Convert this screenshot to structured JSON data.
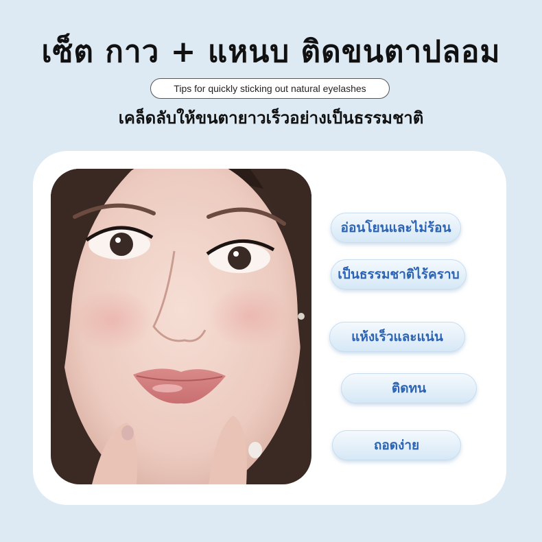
{
  "header": {
    "title": "เซ็ต กาว + แหนบ ติดขนตาปลอม",
    "subtitle_en": "Tips for quickly sticking out natural eyelashes",
    "subtitle_th": "เคล็ดลับให้ขนตายาวเร็วอย่างเป็นธรรมชาติ"
  },
  "features": [
    "อ่อนโยนและไม่ร้อน",
    "เป็นธรรมชาติไร้คราบ",
    "แห้งเร็วและแน่น",
    "ติดทน",
    "ถอดง่าย"
  ],
  "colors": {
    "background": "#ddeaf3",
    "card": "#ffffff",
    "feature_text": "#2c63b2"
  }
}
